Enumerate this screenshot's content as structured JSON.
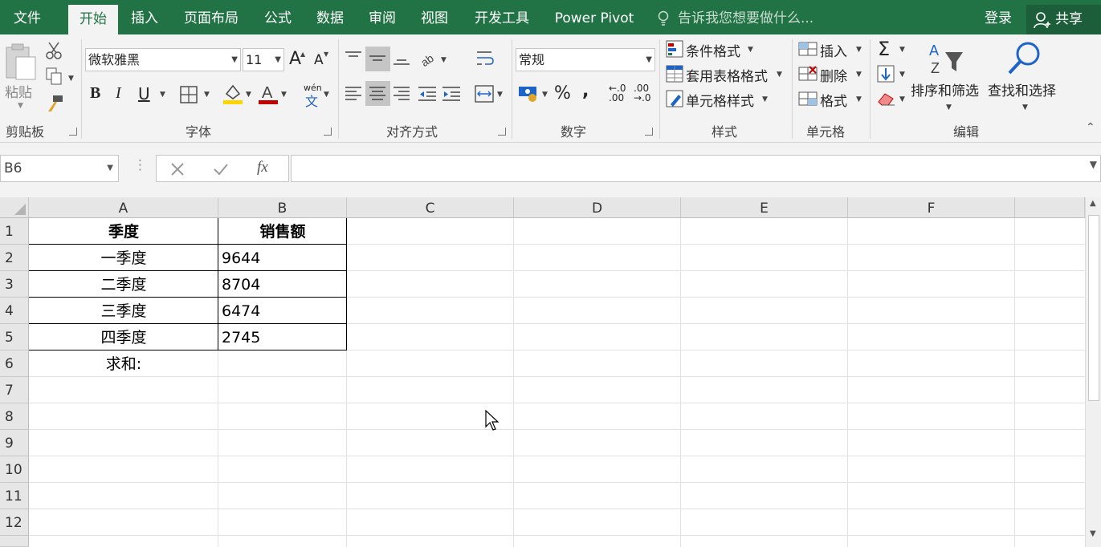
{
  "tabs": {
    "file": "文件",
    "home": "开始",
    "insert": "插入",
    "layout": "页面布局",
    "formulas": "公式",
    "data": "数据",
    "review": "审阅",
    "view": "视图",
    "developer": "开发工具",
    "powerpivot": "Power Pivot",
    "tellme": "告诉我您想要做什么...",
    "login": "登录",
    "share": "共享"
  },
  "clipboard": {
    "paste": "粘贴",
    "label": "剪贴板"
  },
  "font": {
    "name": "微软雅黑",
    "size": "11",
    "label": "字体",
    "bold": "B",
    "italic": "I",
    "underline": "U",
    "grow": "A",
    "shrink": "A",
    "wen": "wén",
    "wen_char": "文"
  },
  "alignment": {
    "label": "对齐方式"
  },
  "number": {
    "format": "常规",
    "label": "数字",
    "percent": "%",
    "comma": ",",
    "inc_dec": "←.0\n.00",
    "dec_dec": ".00\n→.0"
  },
  "styles": {
    "conditional": "条件格式",
    "table": "套用表格格式",
    "cell": "单元格样式",
    "label": "样式"
  },
  "cells": {
    "insert": "插入",
    "delete": "删除",
    "format": "格式",
    "label": "单元格"
  },
  "editing": {
    "sort": "排序和筛选",
    "find": "查找和选择",
    "label": "编辑"
  },
  "formula_bar": {
    "namebox": "B6",
    "fx": "fx",
    "value": ""
  },
  "sheet": {
    "columns": [
      "A",
      "B",
      "C",
      "D",
      "E",
      "F"
    ],
    "rows": [
      "1",
      "2",
      "3",
      "4",
      "5",
      "6",
      "7",
      "8",
      "9",
      "10",
      "11",
      "12"
    ],
    "header": {
      "a": "季度",
      "b": "销售额"
    },
    "data": [
      {
        "a": "一季度",
        "b": "9644"
      },
      {
        "a": "二季度",
        "b": "8704"
      },
      {
        "a": "三季度",
        "b": "6474"
      },
      {
        "a": "四季度",
        "b": "2745"
      }
    ],
    "sum_label": "求和:"
  },
  "colors": {
    "accent": "#217346",
    "ribbon": "#f3f3f3"
  }
}
